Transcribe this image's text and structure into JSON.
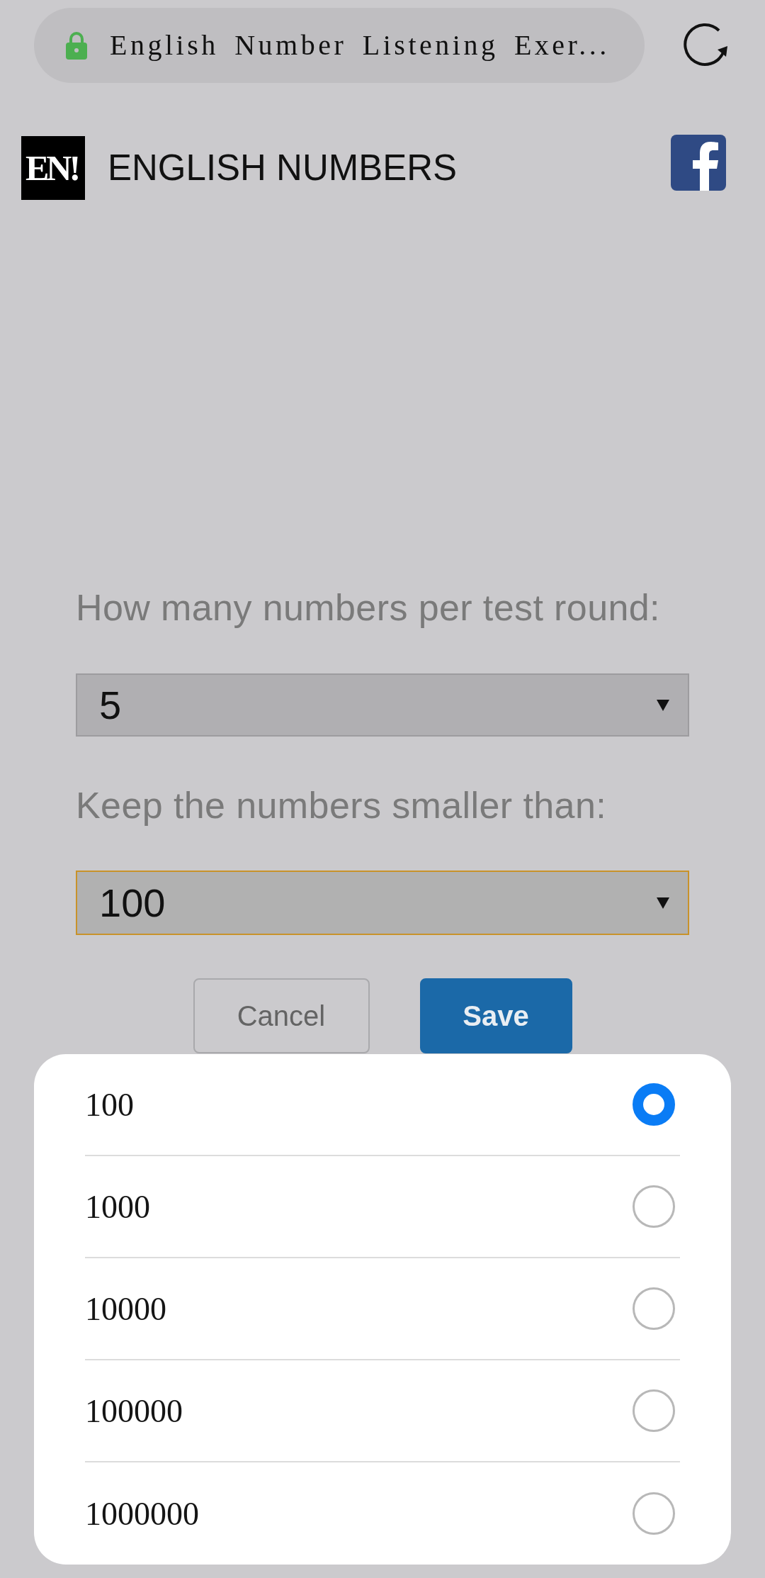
{
  "browser_bar": {
    "title": "English Number Listening Exer..."
  },
  "site_header": {
    "logo_text": "EN!",
    "title": "ENGLISH NUMBERS"
  },
  "settings_form": {
    "fields": [
      {
        "label": "How many numbers per test round:",
        "value": "5",
        "focused": false
      },
      {
        "label": "Keep the numbers smaller than:",
        "value": "100",
        "focused": true
      }
    ],
    "buttons": [
      {
        "label": "Cancel",
        "kind": "secondary"
      },
      {
        "label": "Save",
        "kind": "primary"
      }
    ]
  },
  "picker": {
    "options": [
      {
        "label": "100",
        "selected": true
      },
      {
        "label": "1000",
        "selected": false
      },
      {
        "label": "10000",
        "selected": false
      },
      {
        "label": "100000",
        "selected": false
      },
      {
        "label": "1000000",
        "selected": false
      }
    ]
  }
}
